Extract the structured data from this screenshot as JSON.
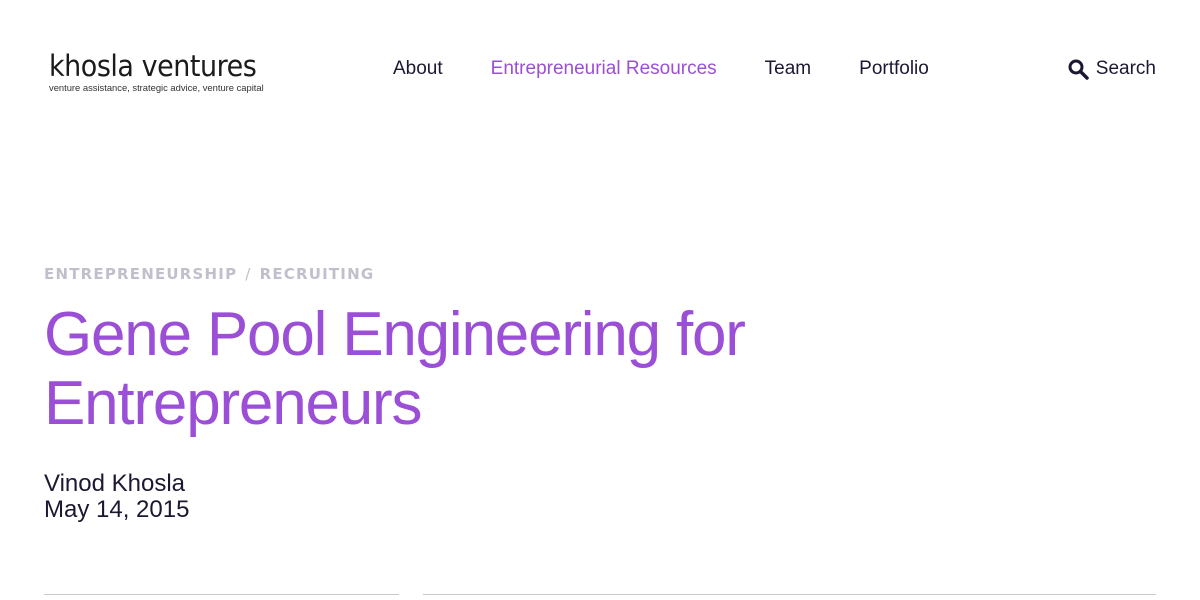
{
  "brand": {
    "name": "khosla ventures",
    "tagline": "venture assistance, strategic advice, venture capital"
  },
  "nav": {
    "items": [
      {
        "label": "About",
        "active": false
      },
      {
        "label": "Entrepreneurial Resources",
        "active": true
      },
      {
        "label": "Team",
        "active": false
      },
      {
        "label": "Portfolio",
        "active": false
      }
    ],
    "search_label": "Search",
    "search_icon": "magnifying-glass"
  },
  "article": {
    "categories": [
      "ENTREPRENEURSHIP",
      "RECRUITING"
    ],
    "category_separator": "/",
    "title": "Gene Pool Engineering for Entrepreneurs",
    "author": "Vinod Khosla",
    "date": "May 14, 2015"
  },
  "colors": {
    "accent": "#9b4fd6",
    "text": "#1c1832",
    "muted": "#c2bfcc",
    "divider": "#c9c9c9"
  }
}
